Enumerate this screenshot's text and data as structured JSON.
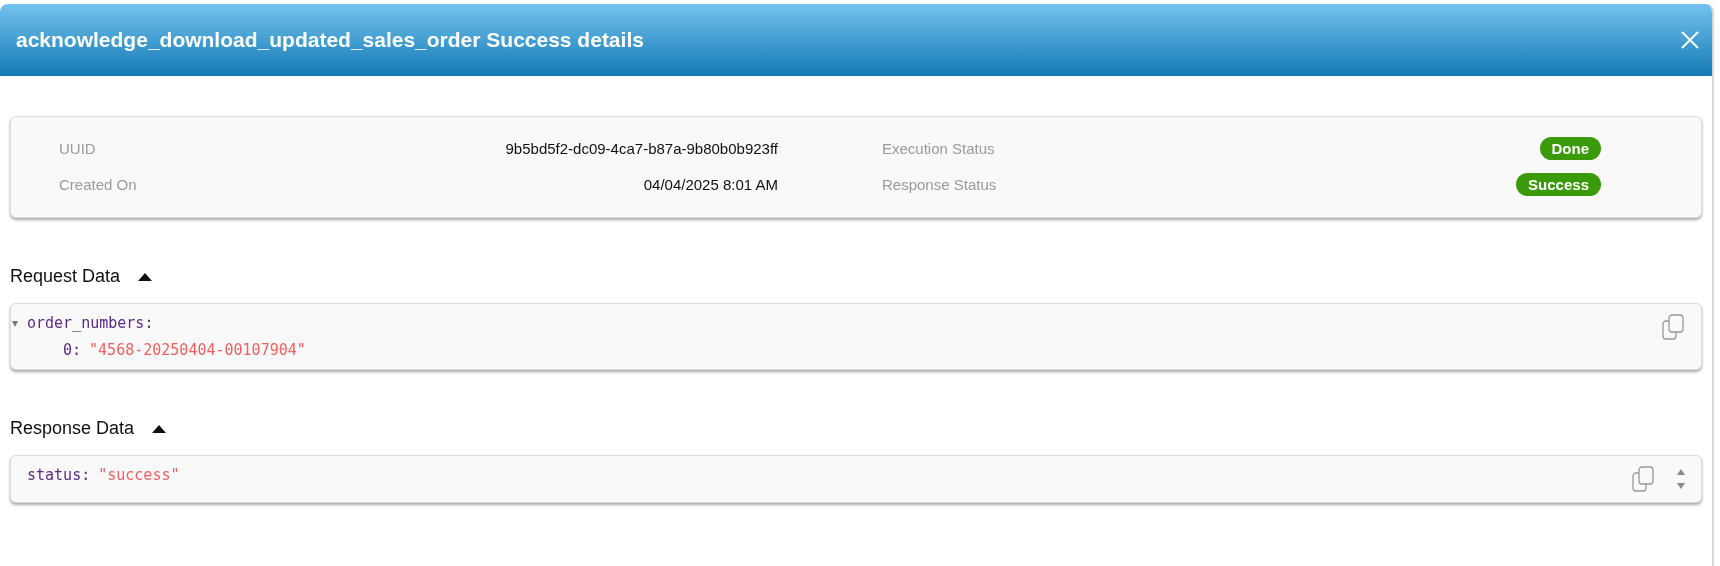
{
  "dialog": {
    "title": "acknowledge_download_updated_sales_order Success details"
  },
  "details": {
    "left": [
      {
        "label": "UUID",
        "value": "9b5bd5f2-dc09-4ca7-b87a-9b80b0b923ff",
        "kind": "text"
      },
      {
        "label": "Created On",
        "value": "04/04/2025 8:01 AM",
        "kind": "text"
      }
    ],
    "right": [
      {
        "label": "Execution Status",
        "value": "Done",
        "kind": "badge"
      },
      {
        "label": "Response Status",
        "value": "Success",
        "kind": "badge"
      }
    ]
  },
  "sections": [
    {
      "title": "Request Data",
      "expanded": true,
      "json": [
        {
          "key": "order_numbers:",
          "expanded": true,
          "children": [
            {
              "key": "0:",
              "value": "\"4568-20250404-00107904\""
            }
          ]
        }
      ]
    },
    {
      "title": "Response Data",
      "expanded": true,
      "json": [
        {
          "key": "status:",
          "value": "\"success\""
        }
      ]
    }
  ]
}
